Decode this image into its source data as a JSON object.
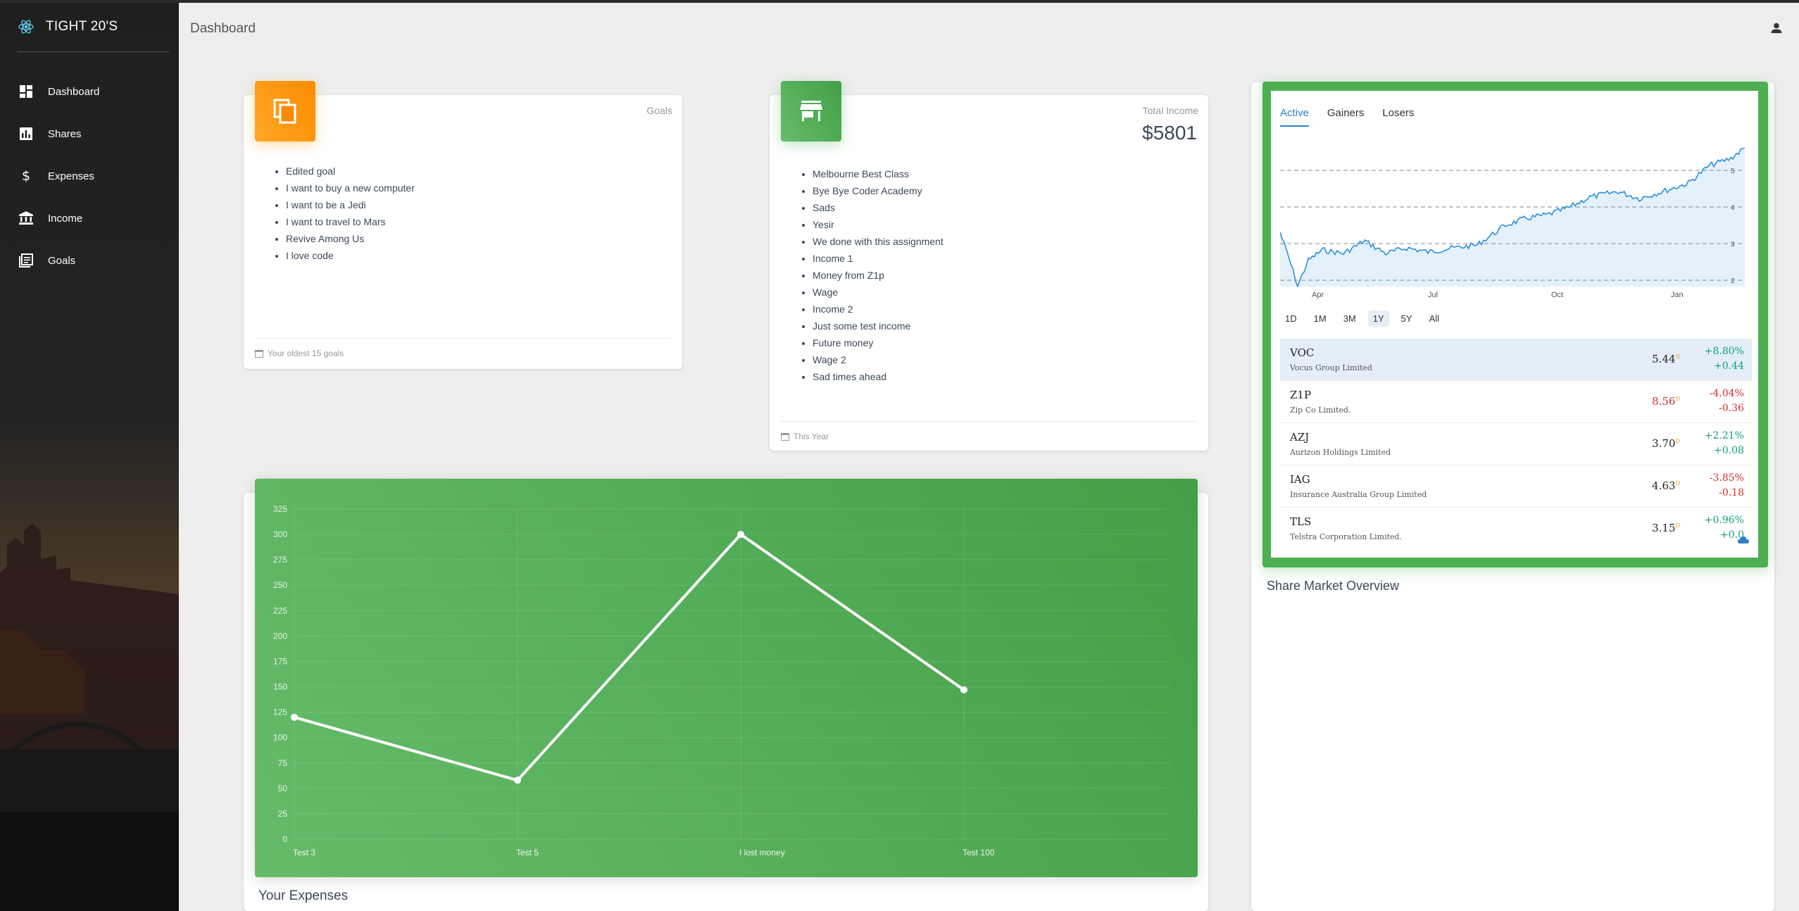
{
  "brand": {
    "name": "TIGHT 20'S"
  },
  "sidebar": {
    "items": [
      {
        "label": "Dashboard",
        "icon": "dashboard-icon"
      },
      {
        "label": "Shares",
        "icon": "bar-chart-icon"
      },
      {
        "label": "Expenses",
        "icon": "dollar-icon"
      },
      {
        "label": "Income",
        "icon": "bank-icon"
      },
      {
        "label": "Goals",
        "icon": "library-books-icon"
      }
    ]
  },
  "header": {
    "title": "Dashboard"
  },
  "goals_card": {
    "category": "Goals",
    "items": [
      "Edited goal",
      "I want to buy a new computer",
      "I want to be a Jedi",
      "I want to travel to Mars",
      "Revive Among Us",
      "I love code"
    ],
    "footer": "Your oldest 15 goals",
    "color": "#fb8c00"
  },
  "income_card": {
    "category": "Total Income",
    "value": "$5801",
    "items": [
      "Melbourne Best Class",
      "Bye Bye Coder Academy",
      "Sads",
      "Yesir",
      "We done with this assignment",
      "Income 1",
      "Money from Z1p",
      "Wage",
      "Income 2",
      "Just some test income",
      "Future money",
      "Wage 2",
      "Sad times ahead"
    ],
    "footer": "This Year",
    "color": "#43a047"
  },
  "expenses_chart": {
    "title": "Your Expenses",
    "y_ticks": [
      "0",
      "25",
      "50",
      "75",
      "100",
      "125",
      "150",
      "175",
      "200",
      "225",
      "250",
      "275",
      "300",
      "325"
    ]
  },
  "chart_data": {
    "type": "line",
    "categories": [
      "Test 3",
      "Test 5",
      "I lost money",
      "Test 100"
    ],
    "series": [
      {
        "values": [
          120,
          58,
          300,
          147
        ]
      }
    ],
    "title": "Your Expenses",
    "xlabel": "",
    "ylabel": "",
    "ylim": [
      0,
      325
    ],
    "grid": true
  },
  "market": {
    "title": "Share Market Overview",
    "tabs": [
      "Active",
      "Gainers",
      "Losers"
    ],
    "active_tab": "Active",
    "ranges": [
      "1D",
      "1M",
      "3M",
      "1Y",
      "5Y",
      "All"
    ],
    "active_range": "1Y",
    "mini_chart": {
      "x_labels": [
        "Apr",
        "Jul",
        "Oct",
        "Jan"
      ],
      "y_labels": [
        "2",
        "3",
        "4",
        "5"
      ],
      "line_color": "#2f8fd8"
    },
    "stocks": [
      {
        "symbol": "VOC",
        "name": "Vocus Group Limited",
        "price": "5.44",
        "pct": "+8.80%",
        "change": "+0.44",
        "direction": "up"
      },
      {
        "symbol": "Z1P",
        "name": "Zip Co Limited.",
        "price": "8.56",
        "pct": "-4.04%",
        "change": "-0.36",
        "direction": "down"
      },
      {
        "symbol": "AZJ",
        "name": "Aurizon Holdings Limited",
        "price": "3.70",
        "pct": "+2.21%",
        "change": "+0.08",
        "direction": "up"
      },
      {
        "symbol": "IAG",
        "name": "Insurance Australia Group Limited",
        "price": "4.63",
        "pct": "-3.85%",
        "change": "-0.18",
        "direction": "down"
      },
      {
        "symbol": "TLS",
        "name": "Telstra Corporation Limited.",
        "price": "3.15",
        "pct": "+0.96%",
        "change": "+0.0",
        "direction": "up"
      }
    ],
    "price_marker": "D"
  }
}
